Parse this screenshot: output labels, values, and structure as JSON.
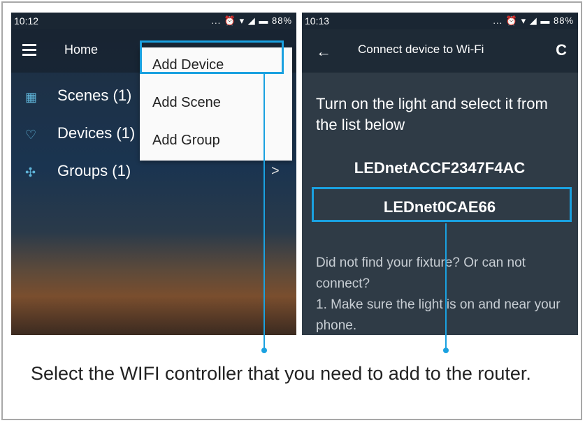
{
  "colors": {
    "highlight": "#1aa1e0",
    "dropdown_bg": "#fafafa",
    "app_bg": "#2f3b46"
  },
  "left_phone": {
    "status": {
      "time": "10:12",
      "icons": "... ⏰ ▾ ◢ ▬ 88%"
    },
    "appbar": {
      "title": "Home",
      "menu_icon": "menu-icon"
    },
    "list": [
      {
        "icon": "scenes-icon",
        "label": "Scenes (1)"
      },
      {
        "icon": "bulb-icon",
        "label": "Devices (1)"
      },
      {
        "icon": "groups-icon",
        "label": "Groups (1)"
      }
    ],
    "chevron": ">",
    "dropdown": [
      "Add Device",
      "Add Scene",
      "Add Group"
    ]
  },
  "right_phone": {
    "status": {
      "time": "10:13",
      "icons": "... ⏰ ▾ ◢ ▬ 88%"
    },
    "appbar": {
      "title": "Connect device to Wi-Fi",
      "back_icon": "back-arrow-icon",
      "refresh_icon": "refresh-icon"
    },
    "instruction": "Turn on the light and select it from the list below",
    "devices": [
      "LEDnetACCF2347F4AC",
      "LEDnet0CAE66"
    ],
    "help": "Did not find your fixture? Or can not connect?\n1. Make sure the light is on and near your phone."
  },
  "caption": "Select the WIFI controller that you need to add to the router."
}
